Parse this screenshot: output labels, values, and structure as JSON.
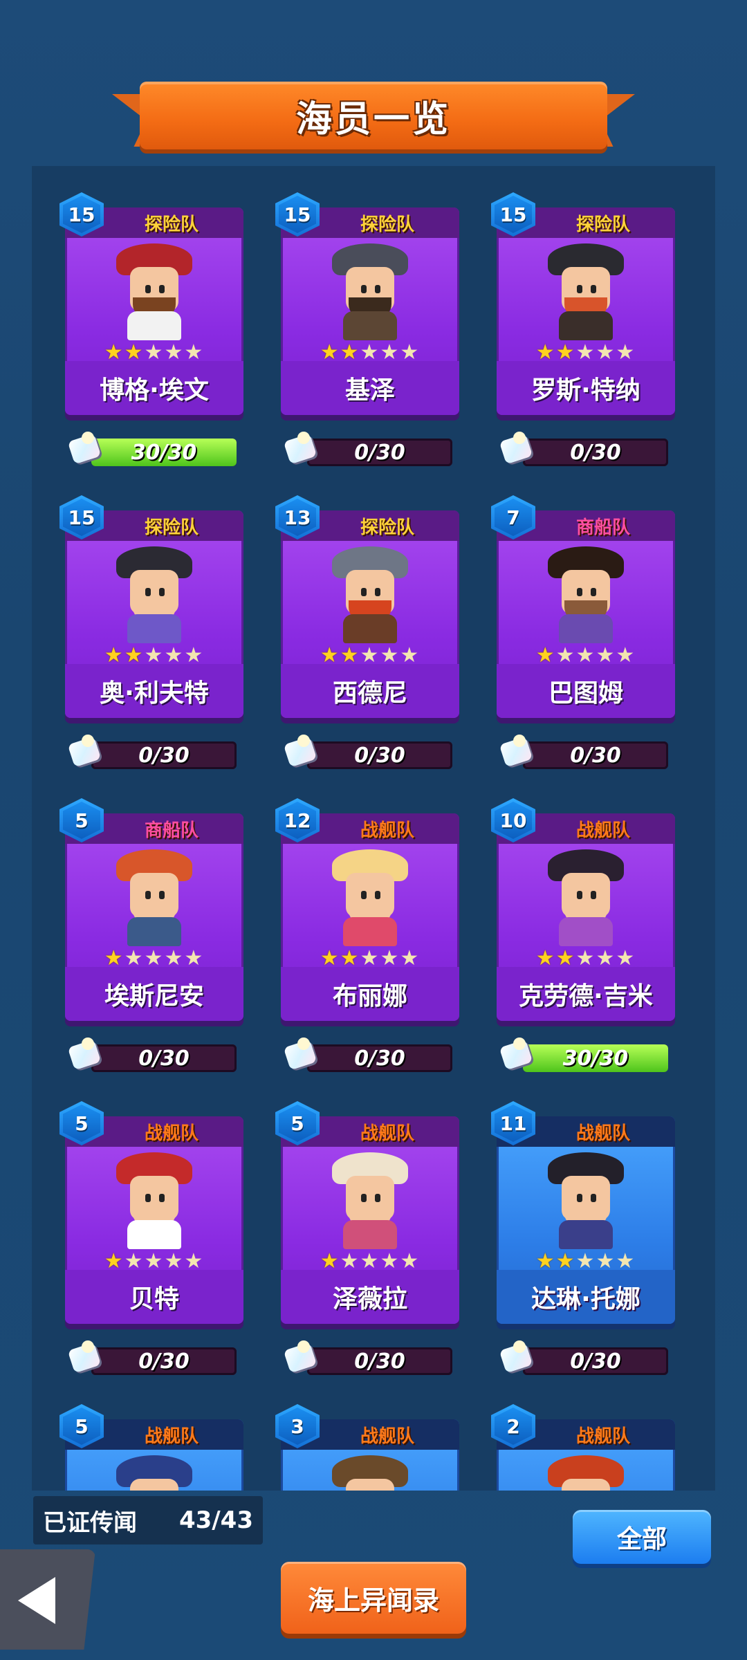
{
  "header": {
    "title": "海员一览"
  },
  "crew": [
    {
      "name": "博格·埃文",
      "team": "探险队",
      "team_type": "explore",
      "level": "15",
      "stars": 2,
      "progress": "30/30",
      "fill": 1.0,
      "theme": "purple",
      "hat": "#b3252a",
      "beard": "#7a4320",
      "body": "#f2f2f2"
    },
    {
      "name": "基泽",
      "team": "探险队",
      "team_type": "explore",
      "level": "15",
      "stars": 2,
      "progress": "0/30",
      "fill": 0,
      "theme": "purple",
      "hat": "#4a4d5a",
      "beard": "#3b2a1d",
      "body": "#5c4634"
    },
    {
      "name": "罗斯·特纳",
      "team": "探险队",
      "team_type": "explore",
      "level": "15",
      "stars": 2,
      "progress": "0/30",
      "fill": 0,
      "theme": "purple",
      "hat": "#2a2a30",
      "beard": "#d8542b",
      "body": "#3a2e2a"
    },
    {
      "name": "奥·利夫特",
      "team": "探险队",
      "team_type": "explore",
      "level": "15",
      "stars": 2,
      "progress": "0/30",
      "fill": 0,
      "theme": "purple",
      "hat": "#2b2a33",
      "beard": "#f4c6a0",
      "body": "#6e58c8"
    },
    {
      "name": "西德尼",
      "team": "探险队",
      "team_type": "explore",
      "level": "13",
      "stars": 2,
      "progress": "0/30",
      "fill": 0,
      "theme": "purple",
      "hat": "#6e7686",
      "beard": "#d6441f",
      "body": "#6a3d27"
    },
    {
      "name": "巴图姆",
      "team": "商船队",
      "team_type": "merchant",
      "level": "7",
      "stars": 1,
      "progress": "0/30",
      "fill": 0,
      "theme": "purple",
      "hat": "#2a1b14",
      "beard": "#8a5a3a",
      "body": "#6a4bb0"
    },
    {
      "name": "埃斯尼安",
      "team": "商船队",
      "team_type": "merchant",
      "level": "5",
      "stars": 1,
      "progress": "0/30",
      "fill": 0,
      "theme": "purple",
      "hat": "#d8562a",
      "beard": "#f4c6a0",
      "body": "#3b5a8a"
    },
    {
      "name": "布丽娜",
      "team": "战舰队",
      "team_type": "battle",
      "level": "12",
      "stars": 2,
      "progress": "0/30",
      "fill": 0,
      "theme": "purple",
      "hat": "#f5d486",
      "beard": "#f4c6a0",
      "body": "#e04a6a"
    },
    {
      "name": "克劳德·吉米",
      "team": "战舰队",
      "team_type": "battle",
      "level": "10",
      "stars": 2,
      "progress": "30/30",
      "fill": 1.0,
      "theme": "purple",
      "hat": "#2a2030",
      "beard": "#f4c6a0",
      "body": "#a14fc7"
    },
    {
      "name": "贝特",
      "team": "战舰队",
      "team_type": "battle",
      "level": "5",
      "stars": 1,
      "progress": "0/30",
      "fill": 0,
      "theme": "purple",
      "hat": "#c42a2a",
      "beard": "#f4c6a0",
      "body": "#ffffff"
    },
    {
      "name": "泽薇拉",
      "team": "战舰队",
      "team_type": "battle",
      "level": "5",
      "stars": 1,
      "progress": "0/30",
      "fill": 0,
      "theme": "purple",
      "hat": "#efe3cc",
      "beard": "#f4c6a0",
      "body": "#d0507a"
    },
    {
      "name": "达琳·托娜",
      "team": "战舰队",
      "team_type": "battle",
      "level": "11",
      "stars": 2,
      "progress": "0/30",
      "fill": 0,
      "theme": "blue",
      "hat": "#23202a",
      "beard": "#f4c6a0",
      "body": "#3a3f8a"
    },
    {
      "name": "",
      "team": "战舰队",
      "team_type": "battle",
      "level": "5",
      "stars": 0,
      "progress": "",
      "fill": 0,
      "theme": "blue",
      "hat": "#2a3f8a",
      "beard": "#f4c6a0",
      "body": "#2a3f8a"
    },
    {
      "name": "",
      "team": "战舰队",
      "team_type": "battle",
      "level": "3",
      "stars": 0,
      "progress": "",
      "fill": 0,
      "theme": "blue",
      "hat": "#6a4a2a",
      "beard": "#f4c6a0",
      "body": "#2a3f8a"
    },
    {
      "name": "",
      "team": "战舰队",
      "team_type": "battle",
      "level": "2",
      "stars": 0,
      "progress": "",
      "fill": 0,
      "theme": "blue",
      "hat": "#c9401e",
      "beard": "#f4c6a0",
      "body": "#2a3f8a"
    }
  ],
  "footer": {
    "count_label": "已证传闻",
    "count_value": "43/43",
    "all_button": "全部",
    "log_button": "海上异闻录"
  },
  "colors": {
    "accent_orange": "#f36b14",
    "card_purple": "#8a2be2",
    "card_blue": "#2d7ee8",
    "progress_green": "#4ec41c"
  }
}
